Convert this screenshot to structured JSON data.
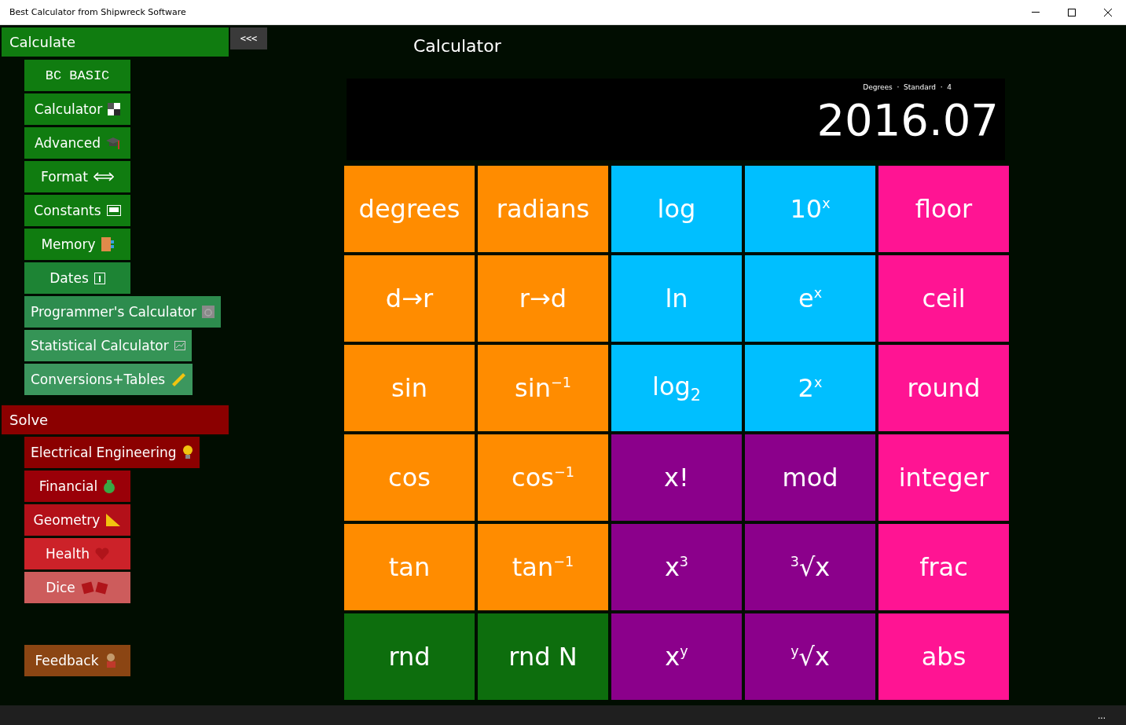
{
  "window": {
    "title": "Best Calculator from Shipwreck Software"
  },
  "sidebar": {
    "collapse_button": "<<<",
    "groups": [
      {
        "title": "Calculate",
        "color": "#107c10",
        "items": [
          {
            "label": "BC BASIC",
            "kind": "mono",
            "color": "#107c10"
          },
          {
            "label": "Calculator",
            "kind": "text",
            "color": "#107c10"
          },
          {
            "label": "Advanced",
            "kind": "text",
            "color": "#107c10"
          },
          {
            "label": "Format",
            "kind": "text",
            "color": "#107c10"
          },
          {
            "label": "Constants",
            "kind": "text",
            "color": "#107c10"
          },
          {
            "label": "Memory",
            "kind": "text",
            "color": "#107c10"
          },
          {
            "label": "Dates",
            "kind": "text",
            "color": "#1d8434"
          },
          {
            "label": "Programmer's Calculator",
            "kind": "text",
            "color": "#2d8c4e"
          },
          {
            "label": "Statistical Calculator",
            "kind": "text",
            "color": "#359456"
          },
          {
            "label": "Conversions+Tables",
            "kind": "text",
            "color": "#3c975e"
          }
        ]
      },
      {
        "title": "Solve",
        "color": "#8b0000",
        "items": [
          {
            "label": "Electrical Engineering",
            "kind": "text",
            "color": "#8b0000"
          },
          {
            "label": "Financial",
            "kind": "text",
            "color": "#9a0008"
          },
          {
            "label": "Geometry",
            "kind": "text",
            "color": "#b31019"
          },
          {
            "label": "Health",
            "kind": "text",
            "color": "#cc2229"
          },
          {
            "label": "Dice",
            "kind": "text",
            "color": "#cd5c5c"
          }
        ]
      }
    ],
    "feedback": {
      "label": "Feedback",
      "color": "#8b4513"
    }
  },
  "page_title": "Calculator",
  "display": {
    "status": "Degrees  ·  Standard  ·  4",
    "value": "2016.07"
  },
  "keys": [
    {
      "label": "degrees",
      "color": "#ff8c00"
    },
    {
      "label": "radians",
      "color": "#ff8c00"
    },
    {
      "label": "log",
      "color": "#00bfff"
    },
    {
      "label": "10$^{x}$",
      "color": "#00bfff"
    },
    {
      "label": "floor",
      "color": "#ff1493"
    },
    {
      "label": "d→r",
      "color": "#ff8c00"
    },
    {
      "label": "r→d",
      "color": "#ff8c00"
    },
    {
      "label": "ln",
      "color": "#00bfff"
    },
    {
      "label": "e$^{x}$",
      "color": "#00bfff"
    },
    {
      "label": "ceil",
      "color": "#ff1493"
    },
    {
      "label": "sin",
      "color": "#ff8c00"
    },
    {
      "label": "sin$^{−1}$",
      "color": "#ff8c00"
    },
    {
      "label": "log$_{2}$",
      "color": "#00bfff"
    },
    {
      "label": "2$^{x}$",
      "color": "#00bfff"
    },
    {
      "label": "round",
      "color": "#ff1493"
    },
    {
      "label": "cos",
      "color": "#ff8c00"
    },
    {
      "label": "cos$^{−1}$",
      "color": "#ff8c00"
    },
    {
      "label": "x!",
      "color": "#8b008b"
    },
    {
      "label": "mod",
      "color": "#8b008b"
    },
    {
      "label": "integer",
      "color": "#ff1493"
    },
    {
      "label": "tan",
      "color": "#ff8c00"
    },
    {
      "label": "tan$^{−1}$",
      "color": "#ff8c00"
    },
    {
      "label": "x$^{3}$",
      "color": "#8b008b"
    },
    {
      "label": "$^{3}$√x",
      "color": "#8b008b"
    },
    {
      "label": "frac",
      "color": "#ff1493"
    },
    {
      "label": "rnd",
      "color": "#0d6e0d"
    },
    {
      "label": "rnd N",
      "color": "#0d6e0d"
    },
    {
      "label": "x$^{y}$",
      "color": "#8b008b"
    },
    {
      "label": "$^{y}$√x",
      "color": "#8b008b"
    },
    {
      "label": "abs",
      "color": "#ff1493"
    }
  ],
  "more_button": "..."
}
